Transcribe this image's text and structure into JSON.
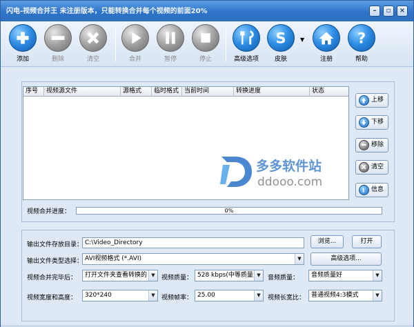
{
  "window": {
    "title": "闪电-视频合并王   未注册版本，只能转换合并每个视频的前面20%"
  },
  "titlebar_buttons": [
    "minimize-icon",
    "restore-icon",
    "close-icon"
  ],
  "toolbar": {
    "items": [
      {
        "label": "添加",
        "icon": "add-icon",
        "enabled": true
      },
      {
        "label": "删除",
        "icon": "remove-icon",
        "enabled": false
      },
      {
        "label": "清空",
        "icon": "clear-icon",
        "enabled": false
      },
      {
        "label": "合并",
        "icon": "play-icon",
        "enabled": false
      },
      {
        "label": "暂停",
        "icon": "pause-icon",
        "enabled": false
      },
      {
        "label": "停止",
        "icon": "stop-icon",
        "enabled": false
      },
      {
        "label": "高级选项",
        "icon": "advanced-options-icon",
        "enabled": true
      },
      {
        "label": "皮肤",
        "icon": "skin-icon",
        "enabled": true
      },
      {
        "label": "注册",
        "icon": "home-icon",
        "enabled": true
      },
      {
        "label": "帮助",
        "icon": "help-icon",
        "enabled": true
      }
    ]
  },
  "list": {
    "columns": [
      "序号",
      "视频源文件",
      "源格式",
      "临时格式",
      "当前时间",
      "转换进度",
      "状态"
    ],
    "rows": []
  },
  "side_buttons": [
    {
      "label": "上移",
      "icon": "arrow-up-icon"
    },
    {
      "label": "下移",
      "icon": "arrow-down-icon"
    },
    {
      "label": "移除",
      "icon": "minus-icon"
    },
    {
      "label": "清空",
      "icon": "clear-icon"
    },
    {
      "label": "信息",
      "icon": "info-icon"
    }
  ],
  "progress": {
    "label": "视频合并进度：",
    "value": 0,
    "text": "0%"
  },
  "watermark": {
    "cn": "多多软件站",
    "en": "ddooo.com"
  },
  "settings": {
    "output_dir_label": "输出文件存放目录：",
    "output_dir_value": "C:\\Video_Directory",
    "browse_label": "浏览...",
    "open_label": "打开",
    "output_type_label": "输出文件类型选择：",
    "output_type_value": "AVI视频格式 (*.AVI)",
    "advanced_label": "高级选项...",
    "after_merge_label": "视频合并完毕后：",
    "after_merge_value": "打开文件夹查看转换的",
    "video_quality_label": "视频质量：",
    "video_quality_value": "528 kbps(中等质量)",
    "audio_quality_label": "音频质量：",
    "audio_quality_value": "音频质量好",
    "size_label": "视频宽度和高度：",
    "size_value": "320*240",
    "fps_label": "视频帧率：",
    "fps_value": "25.00",
    "aspect_label": "视频长宽比：",
    "aspect_value": "普通视频4:3模式"
  },
  "colors": {
    "accent": "#2e74c9",
    "window_bg": "#dfe9f5",
    "disabled_text": "#8a8a8a",
    "watermark": "#2a72c8"
  }
}
